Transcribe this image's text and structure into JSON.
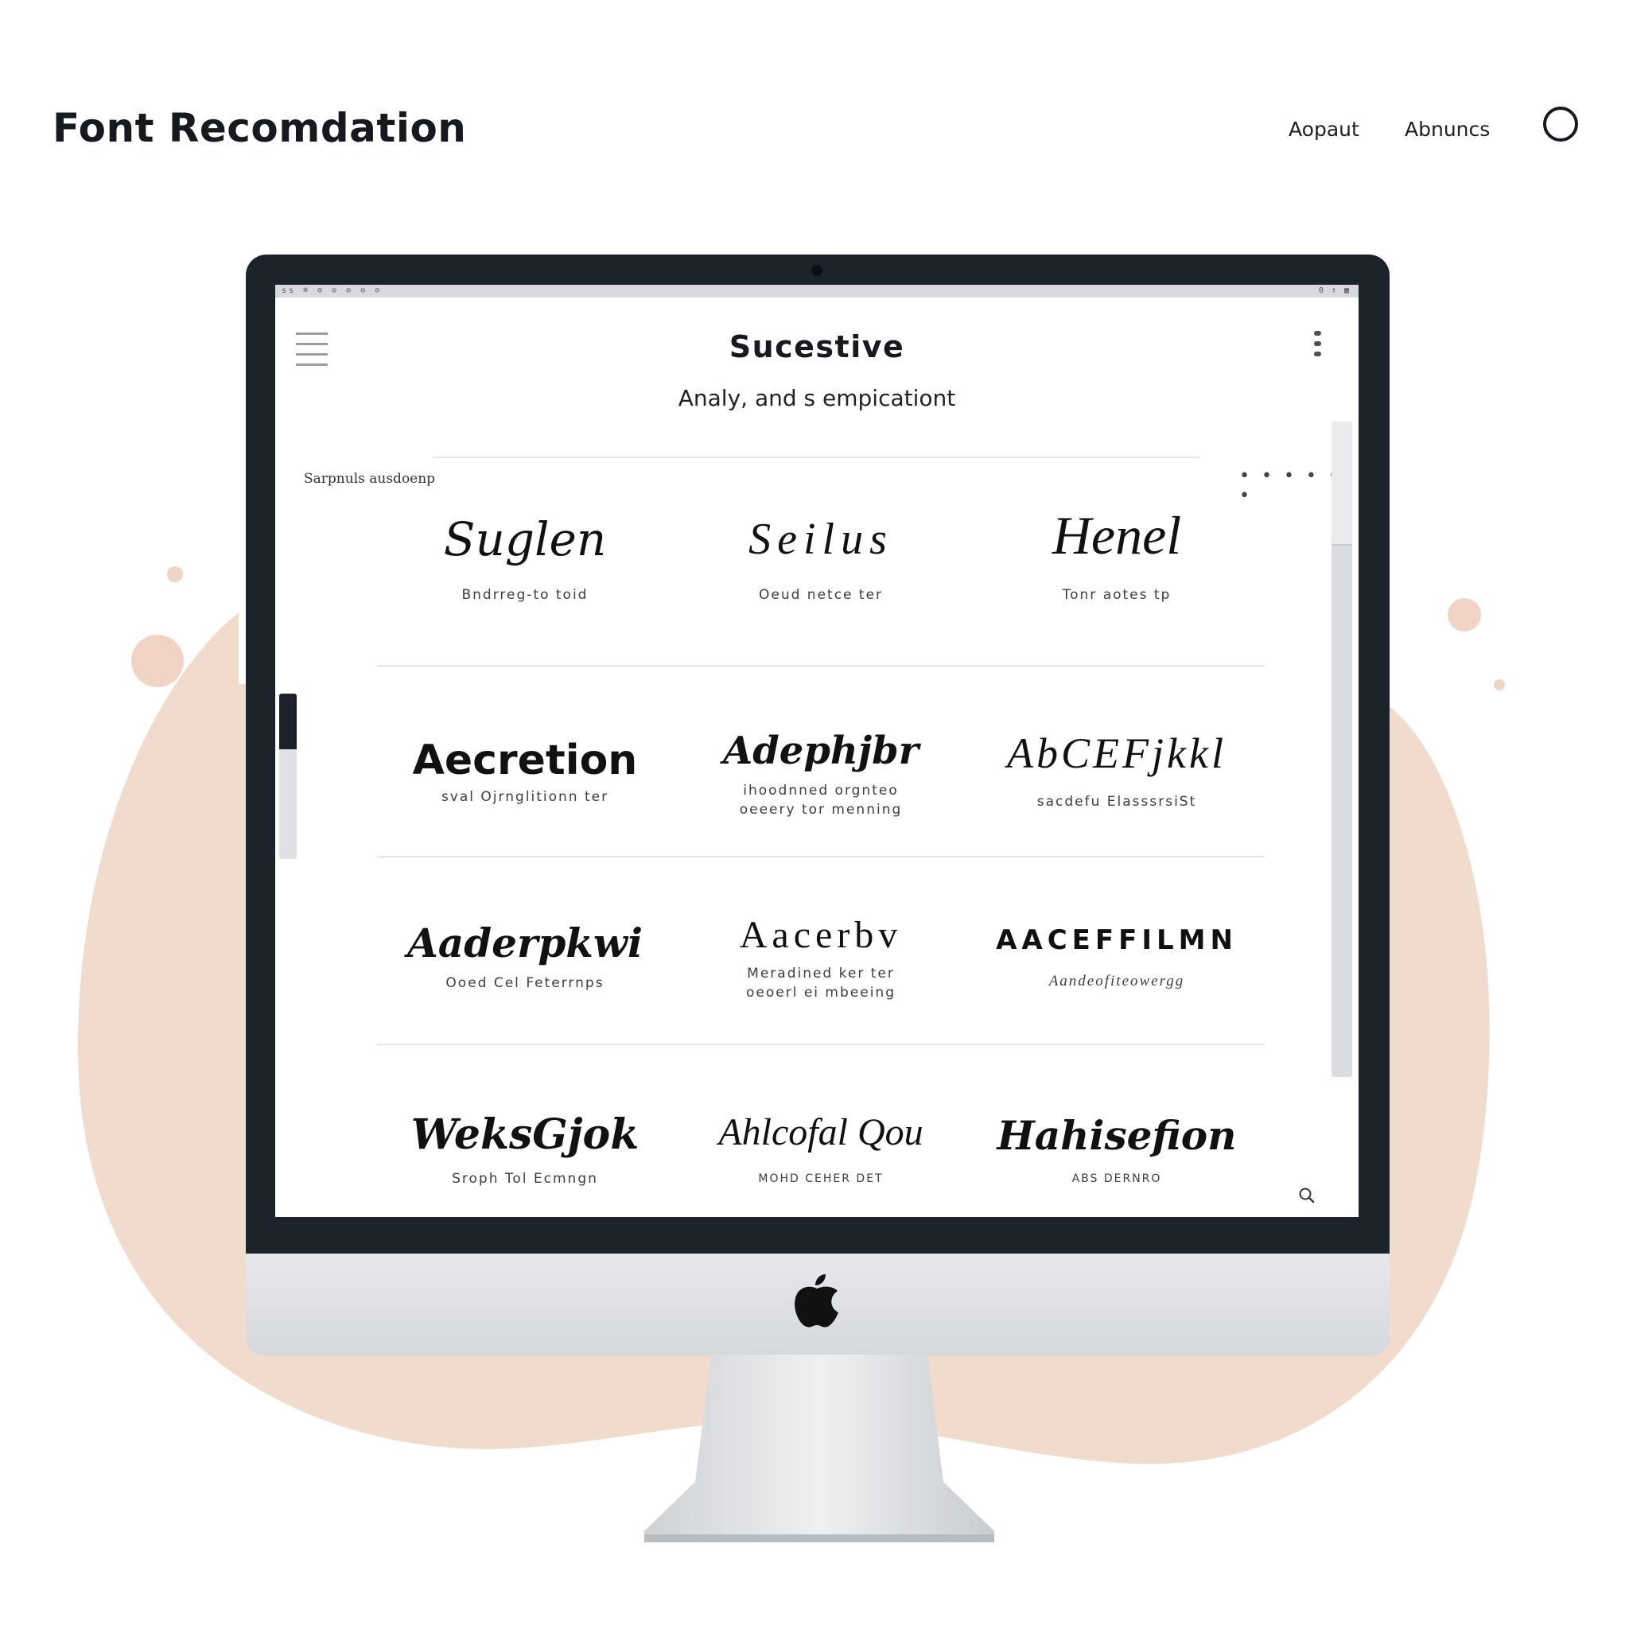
{
  "site": {
    "title": "Font Recomdation",
    "nav": [
      "Aopaut",
      "Abnuncs"
    ]
  },
  "screen": {
    "app_title": "Sucestive",
    "app_subtitle": "Analy, and s empicationt",
    "section_label": "Sarpnuls ausdoenp",
    "more_dots": "• • • • • •",
    "menubar_left": "ss ⌘ ⊙ ⊙ ⊙ ⊙ ⊙",
    "menubar_right": "0 ↑ ▦"
  },
  "fonts": [
    {
      "sample": "Suglen",
      "caption": "Bndrreg-to toid"
    },
    {
      "sample": "Seilus",
      "caption": "Oeud netce ter"
    },
    {
      "sample": "Henel",
      "caption": "Tonr aotes tp"
    },
    {
      "sample": "Aecretion",
      "caption": "sval Ojrnglitionn ter"
    },
    {
      "sample": "Adephjbr",
      "caption": "ihoodnned orgnteo\noeeery tor menning"
    },
    {
      "sample": "AbCEFjkkl",
      "caption": "sacdefu ElasssrsiSt"
    },
    {
      "sample": "Aaderpkwi",
      "caption": "Ooed Cel Feterrnps"
    },
    {
      "sample": "Aacerbv",
      "caption": "Meradined ker ter\noeoerl ei mbeeing"
    },
    {
      "sample": "AACEFFILMN",
      "caption": "Aandeofiteowergg"
    },
    {
      "sample": "WeksGjok",
      "caption": "Sroph Tol Ecmngn"
    },
    {
      "sample": "Ahlcofal Qou",
      "caption": "MOHD CEHER DET"
    },
    {
      "sample": "Hahisefion",
      "caption": "ABS DERNRO"
    }
  ],
  "colors": {
    "bezel": "#1b2229",
    "blob": "#f1dbcd",
    "accent_dot": "#f1d4c4"
  },
  "icons": [
    "hamburger-icon",
    "kebab-menu-icon",
    "search-icon",
    "apple-logo-icon",
    "circle-icon"
  ]
}
